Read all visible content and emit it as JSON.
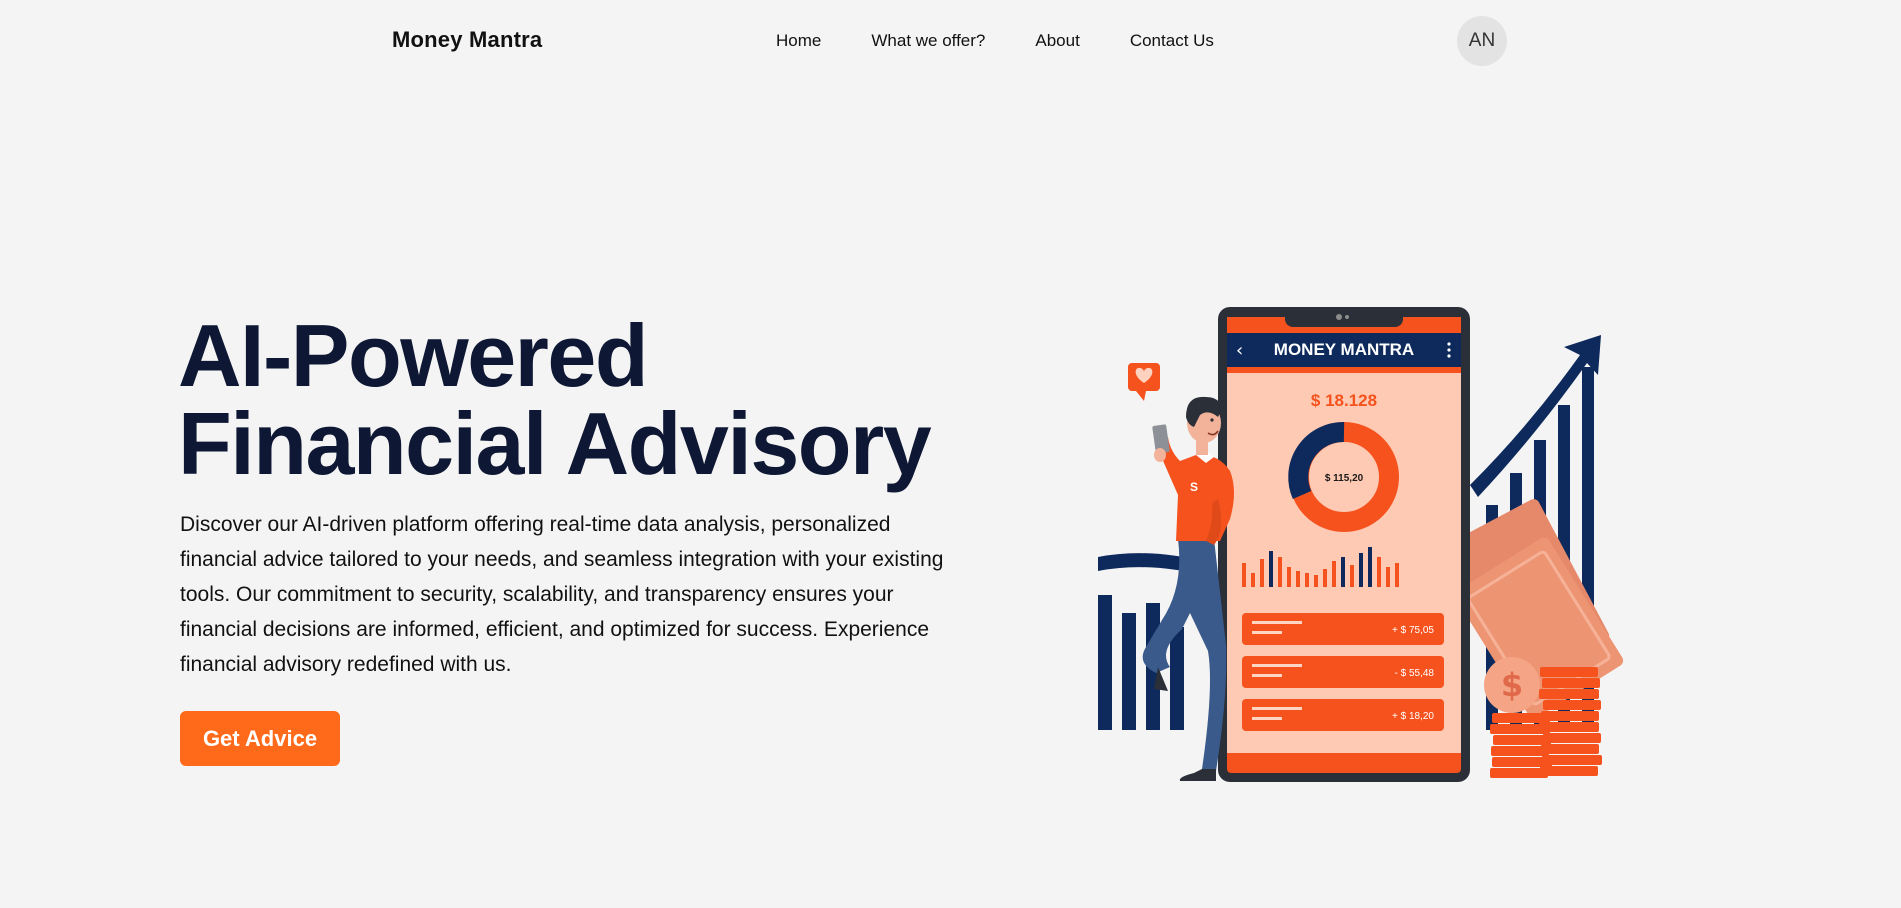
{
  "nav": {
    "brand": "Money Mantra",
    "links": [
      "Home",
      "What we offer?",
      "About",
      "Contact Us"
    ],
    "avatar_initials": "AN"
  },
  "hero": {
    "title_line1": "AI-Powered",
    "title_line2": "Financial Advisory",
    "description": "Discover our AI-driven platform offering real-time data analysis, personalized financial advice tailored to your needs, and seamless integration with your existing tools. Our commitment to security, scalability, and transparency ensures your financial decisions are informed, efficient, and optimized for success. Experience financial advisory redefined with us.",
    "cta_label": "Get Advice"
  },
  "illustration": {
    "app_name": "MONEY MANTRA",
    "balance": "$ 18.128",
    "donut_value": "$ 115,20",
    "transactions": [
      "+ $ 75,05",
      "- $ 55,48",
      "+ $ 18,20"
    ],
    "shirt_letter": "S"
  },
  "colors": {
    "accent": "#ff6a1a",
    "navy": "#0e1733",
    "background": "#f4f4f4"
  }
}
